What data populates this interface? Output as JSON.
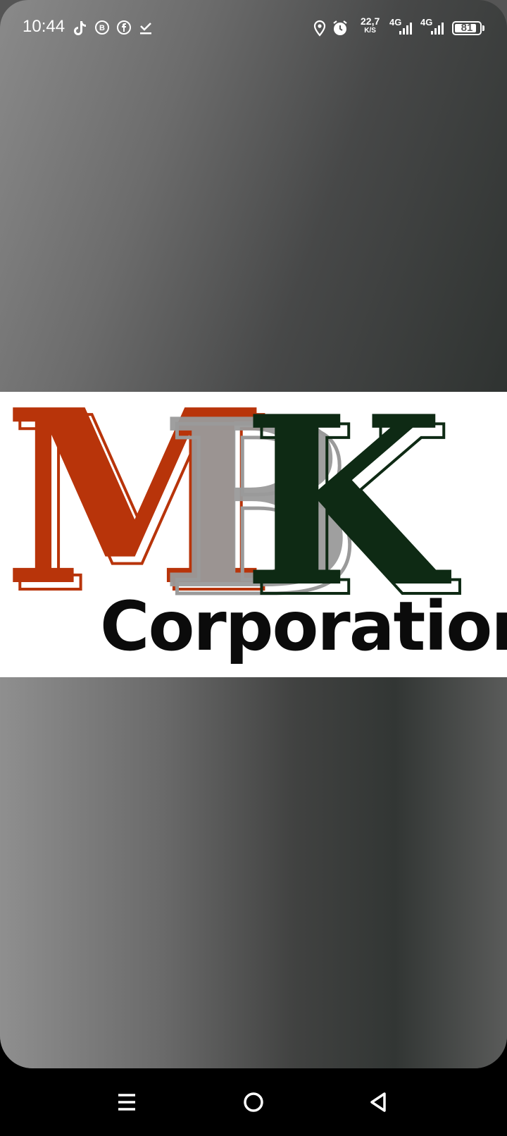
{
  "status_bar": {
    "time": "10:44",
    "notification_icons": [
      "tiktok-icon",
      "whatsapp-business-icon",
      "facebook-icon",
      "download-done-icon"
    ],
    "net_speed": "22,7",
    "net_speed_unit": "K/S",
    "sim1_label": "4G",
    "sim2_label": "4G",
    "battery_level": "81"
  },
  "logo": {
    "letters": [
      "M",
      "B",
      "K"
    ],
    "subtitle": "Corporation",
    "colors": {
      "m": "#b8340a",
      "b": "#9a9a9a",
      "k": "#0e2a14",
      "text": "#0b0b0b"
    }
  },
  "nav": {
    "buttons": [
      "menu-icon",
      "home-icon",
      "back-icon"
    ]
  }
}
